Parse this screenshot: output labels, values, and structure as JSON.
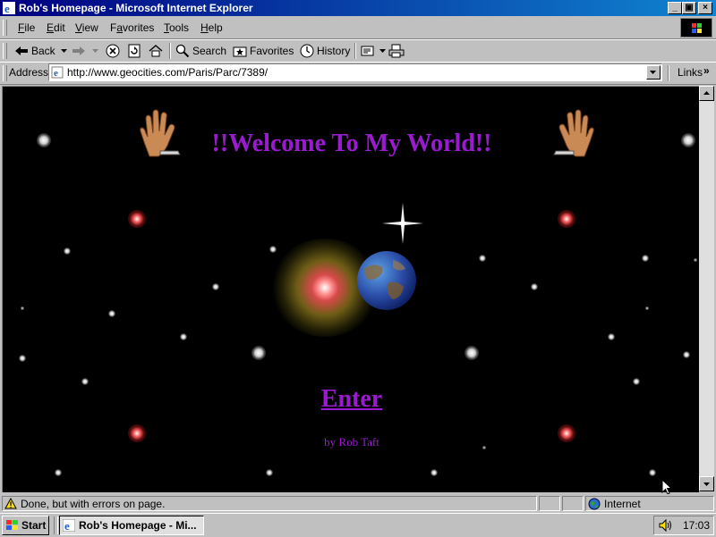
{
  "window": {
    "title": "Rob's Homepage - Microsoft Internet Explorer",
    "min_glyph": "_",
    "max_glyph": "▣",
    "close_glyph": "×"
  },
  "menubar": {
    "items": [
      {
        "label": "File",
        "access": "F",
        "rest": "ile"
      },
      {
        "label": "Edit",
        "access": "E",
        "rest": "dit"
      },
      {
        "label": "View",
        "access": "V",
        "rest": "iew"
      },
      {
        "label": "Favorites",
        "access": "a",
        "pre": "F",
        "rest": "vorites"
      },
      {
        "label": "Tools",
        "access": "T",
        "rest": "ools"
      },
      {
        "label": "Help",
        "access": "H",
        "rest": "elp"
      }
    ]
  },
  "toolbar": {
    "back": "Back",
    "search": "Search",
    "favorites": "Favorites",
    "history": "History"
  },
  "address": {
    "label": "Address",
    "url": "http://www.geocities.com/Paris/Parc/7389/",
    "links": "Links",
    "links_more": "»"
  },
  "page": {
    "welcome": "!!Welcome To My World!!",
    "enter": "Enter",
    "byline": "by Rob Taft",
    "text_color": "#9a1ad0",
    "background": "#000000"
  },
  "status": {
    "text": "Done, but with errors on page.",
    "zone": "Internet"
  },
  "taskbar": {
    "start": "Start",
    "task": "Rob's Homepage - Mi...",
    "clock": "17:03"
  }
}
